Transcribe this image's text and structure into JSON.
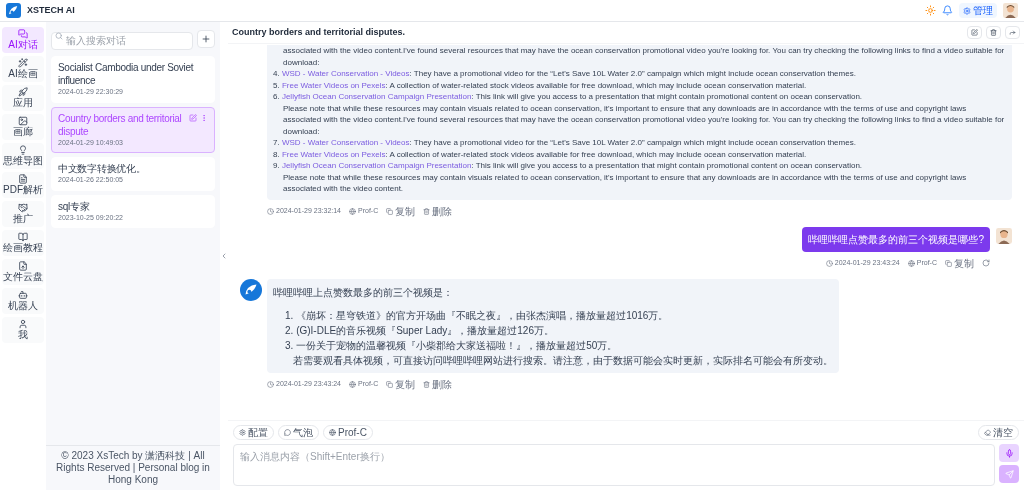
{
  "app": {
    "title": "XSTECH AI",
    "admin_button": "管理"
  },
  "nav": [
    {
      "label": "AI对话",
      "selected": true
    },
    {
      "label": "AI绘画",
      "selected": false
    },
    {
      "label": "应用",
      "selected": false
    },
    {
      "label": "画廊",
      "selected": false
    },
    {
      "label": "思维导图",
      "selected": false
    },
    {
      "label": "PDF解析",
      "selected": false
    },
    {
      "label": "推广",
      "selected": false
    },
    {
      "label": "绘画教程",
      "selected": false
    },
    {
      "label": "文件云盘",
      "selected": false
    },
    {
      "label": "机器人",
      "selected": false
    },
    {
      "label": "我",
      "selected": false
    }
  ],
  "search": {
    "placeholder": "输入搜索对话"
  },
  "conversations": [
    {
      "title": "Socialist Cambodia under Soviet influence",
      "time": "2024-01-29 22:30:29",
      "selected": false
    },
    {
      "title": "Country borders and territorial dispute",
      "time": "2024-01-29 10:49:03",
      "selected": true
    },
    {
      "title": "中文数字转换优化。",
      "time": "2024-01-26 22:50:05",
      "selected": false
    },
    {
      "title": "sql专家",
      "time": "2023-10-25 09:20:22",
      "selected": false
    }
  ],
  "footer": "© 2023 XsTech by 潇洒科技 | All Rights Reserved | Personal blog in Hong Kong",
  "chat": {
    "title": "Country borders and territorial disputes."
  },
  "messages": [
    {
      "kind": "assistant",
      "blocks": [
        {
          "kind": "paragraph",
          "text": "associated with the video content.I've found several resources that may have the ocean conservation promotional video you're looking for. You can try checking the following links to find a video suitable for download:"
        },
        {
          "kind": "item",
          "number": "4.",
          "link": "WSD - Water Conservation - Videos",
          "text": ": They have a promotional video for the “Let's Save 10L Water 2.0” campaign which might include ocean conservation themes."
        },
        {
          "kind": "item",
          "number": "5.",
          "link": "Free Water Videos on Pexels",
          "text": ": A collection of water-related stock videos available for free download, which may include ocean conservation material."
        },
        {
          "kind": "item",
          "number": "6.",
          "link": "Jellyfish Ocean Conservation Campaign Presentation",
          "text": ": This link will give you access to a presentation that might contain promotional content on ocean conservation."
        },
        {
          "kind": "paragraph",
          "text": "Please note that while these resources may contain visuals related to ocean conservation, it's important to ensure that any downloads are in accordance with the terms of use and copyright laws associated with the video content.I've found several resources that may have the ocean conservation promotional video you're looking for. You can try checking the following links to find a video suitable for download:"
        },
        {
          "kind": "item",
          "number": "7.",
          "link": "WSD - Water Conservation - Videos",
          "text": ": They have a promotional video for the “Let's Save 10L Water 2.0” campaign which might include ocean conservation themes."
        },
        {
          "kind": "item",
          "number": "8.",
          "link": "Free Water Videos on Pexels",
          "text": ": A collection of water-related stock videos available for free download, which may include ocean conservation material."
        },
        {
          "kind": "item",
          "number": "9.",
          "link": "Jellyfish Ocean Conservation Campaign Presentation",
          "text": ": This link will give you access to a presentation that might contain promotional content on ocean conservation."
        },
        {
          "kind": "paragraph",
          "text": "Please note that while these resources may contain visuals related to ocean conservation, it's important to ensure that any downloads are in accordance with the terms of use and copyright laws associated with the video content."
        }
      ],
      "meta": {
        "time": "2024-01-29 23:32:14",
        "model": "Prof-C",
        "copy": "复制",
        "delete": "删除"
      }
    },
    {
      "kind": "user",
      "text": "哔哩哔哩点赞最多的前三个视频是哪些?",
      "meta": {
        "time": "2024-01-29 23:43:24",
        "model": "Prof-C",
        "copy": "复制"
      }
    },
    {
      "kind": "assistant",
      "blocks": [
        {
          "kind": "lead",
          "text": "哔哩哔哩上点赞数最多的前三个视频是："
        },
        {
          "kind": "item",
          "number": "1.",
          "text": "《崩坏：星穹铁道》的官方开场曲『不眠之夜』，由张杰演唱，播放量超过1016万。"
        },
        {
          "kind": "item",
          "number": "2.",
          "text": "(G)I-DLE的音乐视频『Super Lady』，播放量超过126万。"
        },
        {
          "kind": "item",
          "number": "3.",
          "text": "一份关于宠物的温馨视频『小柴郡给大家送福啦！』，播放量超过50万。"
        },
        {
          "kind": "paragraph",
          "text": "若需要观看具体视频，可直接访问哔哩哔哩网站进行搜索。请注意，由于数据可能会实时更新，实际排名可能会有所变动。"
        }
      ],
      "meta": {
        "time": "2024-01-29 23:43:24",
        "model": "Prof-C",
        "copy": "复制",
        "delete": "删除"
      }
    }
  ],
  "toolbar": {
    "chips": [
      "配置",
      "气泡",
      "Prof-C"
    ],
    "clear": "清空"
  },
  "composer": {
    "placeholder": "输入消息内容（Shift+Enter换行）"
  }
}
